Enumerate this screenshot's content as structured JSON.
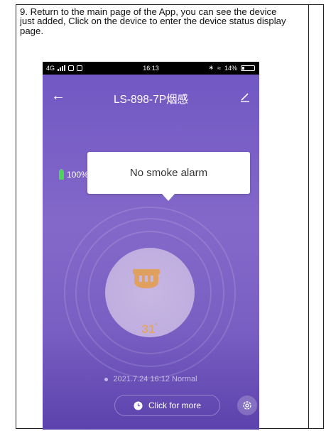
{
  "instruction": "9. Return to the main page of the App, you can see the device just added, Click on the device to enter the device status display page.",
  "statusbar": {
    "network": "4G",
    "time": "16:13",
    "battery": "14%"
  },
  "app": {
    "title": "LS-898-7P烟感",
    "battery_level": "100%",
    "alarm_popup": "No smoke alarm",
    "temperature": "31",
    "temperature_unit": "°",
    "last_status": "2021.7.24 16:12 Normal",
    "more_button": "Click for more"
  },
  "colors": {
    "app_background": "#7a5fc3",
    "battery_indicator": "#4ed35c",
    "temperature_text": "#e2a469",
    "sensor_icon": "#e0a060"
  },
  "icons": {
    "back": "arrow-left-icon",
    "edit": "pencil-icon",
    "battery": "battery-icon",
    "device": "smoke-sensor-icon",
    "more": "clock-icon",
    "settings": "gear-icon"
  }
}
